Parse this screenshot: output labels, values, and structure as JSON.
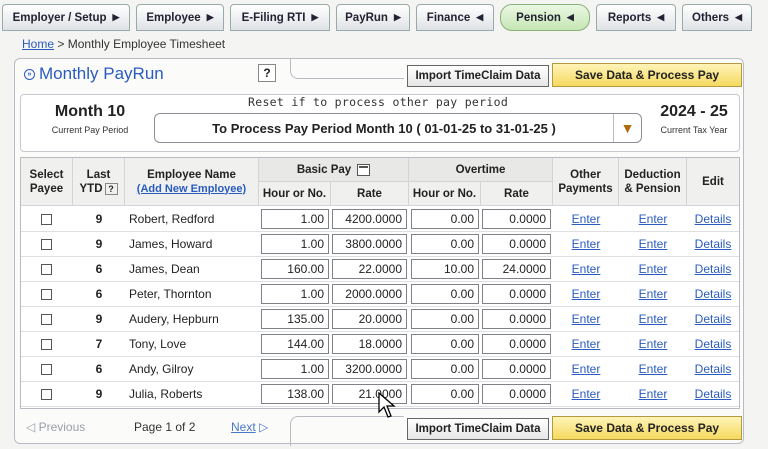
{
  "nav": [
    {
      "label": "Employer / Setup",
      "arrow": "▶"
    },
    {
      "label": "Employee",
      "arrow": "▶"
    },
    {
      "label": "E-Filing RTI",
      "arrow": "▶"
    },
    {
      "label": "PayRun",
      "arrow": "▶"
    },
    {
      "label": "Finance",
      "arrow": "◀"
    },
    {
      "label": "Pension",
      "arrow": "◀"
    },
    {
      "label": "Reports",
      "arrow": "◀"
    },
    {
      "label": "Others",
      "arrow": "◀"
    }
  ],
  "breadcrumb": {
    "home": "Home",
    "separator": ">",
    "current": "Monthly Employee Timesheet"
  },
  "title": "Monthly PayRun",
  "help": "?",
  "buttons": {
    "import": "Import TimeClaim Data",
    "save": "Save Data & Process Pay"
  },
  "period": {
    "month": "Month 10",
    "month_caption": "Current Pay Period",
    "reset_note": "Reset if to process other pay period",
    "selected": "To Process Pay Period Month 10 ( 01-01-25 to 31-01-25 )",
    "year": "2024 - 25",
    "year_caption": "Current Tax Year"
  },
  "table": {
    "headers": {
      "select": "Select Payee",
      "last": "Last",
      "ytd": "YTD",
      "ytd_help": "?",
      "name": "Employee Name",
      "add_new": "(Add New Employee)",
      "basic_pay": "Basic Pay",
      "overtime": "Overtime",
      "hour_or_no": "Hour or No.",
      "rate": "Rate",
      "other_payments": "Other Payments",
      "deduction": "Deduction & Pension",
      "edit": "Edit"
    },
    "rows": [
      {
        "ytd": "9",
        "name": "Robert, Redford",
        "basic_hours": "1.00",
        "basic_rate": "4200.0000",
        "ot_hours": "0.00",
        "ot_rate": "0.0000",
        "other": "Enter",
        "deduction": "Enter",
        "edit": "Details"
      },
      {
        "ytd": "9",
        "name": "James, Howard",
        "basic_hours": "1.00",
        "basic_rate": "3800.0000",
        "ot_hours": "0.00",
        "ot_rate": "0.0000",
        "other": "Enter",
        "deduction": "Enter",
        "edit": "Details"
      },
      {
        "ytd": "6",
        "name": "James, Dean",
        "basic_hours": "160.00",
        "basic_rate": "22.0000",
        "ot_hours": "10.00",
        "ot_rate": "24.0000",
        "other": "Enter",
        "deduction": "Enter",
        "edit": "Details"
      },
      {
        "ytd": "6",
        "name": "Peter, Thornton",
        "basic_hours": "1.00",
        "basic_rate": "2000.0000",
        "ot_hours": "0.00",
        "ot_rate": "0.0000",
        "other": "Enter",
        "deduction": "Enter",
        "edit": "Details"
      },
      {
        "ytd": "9",
        "name": "Audery, Hepburn",
        "basic_hours": "135.00",
        "basic_rate": "20.0000",
        "ot_hours": "0.00",
        "ot_rate": "0.0000",
        "other": "Enter",
        "deduction": "Enter",
        "edit": "Details"
      },
      {
        "ytd": "7",
        "name": "Tony, Love",
        "basic_hours": "144.00",
        "basic_rate": "18.0000",
        "ot_hours": "0.00",
        "ot_rate": "0.0000",
        "other": "Enter",
        "deduction": "Enter",
        "edit": "Details"
      },
      {
        "ytd": "6",
        "name": "Andy, Gilroy",
        "basic_hours": "1.00",
        "basic_rate": "3200.0000",
        "ot_hours": "0.00",
        "ot_rate": "0.0000",
        "other": "Enter",
        "deduction": "Enter",
        "edit": "Details"
      },
      {
        "ytd": "9",
        "name": "Julia, Roberts",
        "basic_hours": "138.00",
        "basic_rate": "21.0000",
        "ot_hours": "0.00",
        "ot_rate": "0.0000",
        "other": "Enter",
        "deduction": "Enter",
        "edit": "Details"
      }
    ]
  },
  "pagination": {
    "previous": "Previous",
    "page": "Page 1 of 2",
    "next": "Next"
  },
  "colors": {
    "link": "#2a5bbf",
    "save_button": "#f5d95f",
    "active_tab": "#c6e6b4"
  }
}
